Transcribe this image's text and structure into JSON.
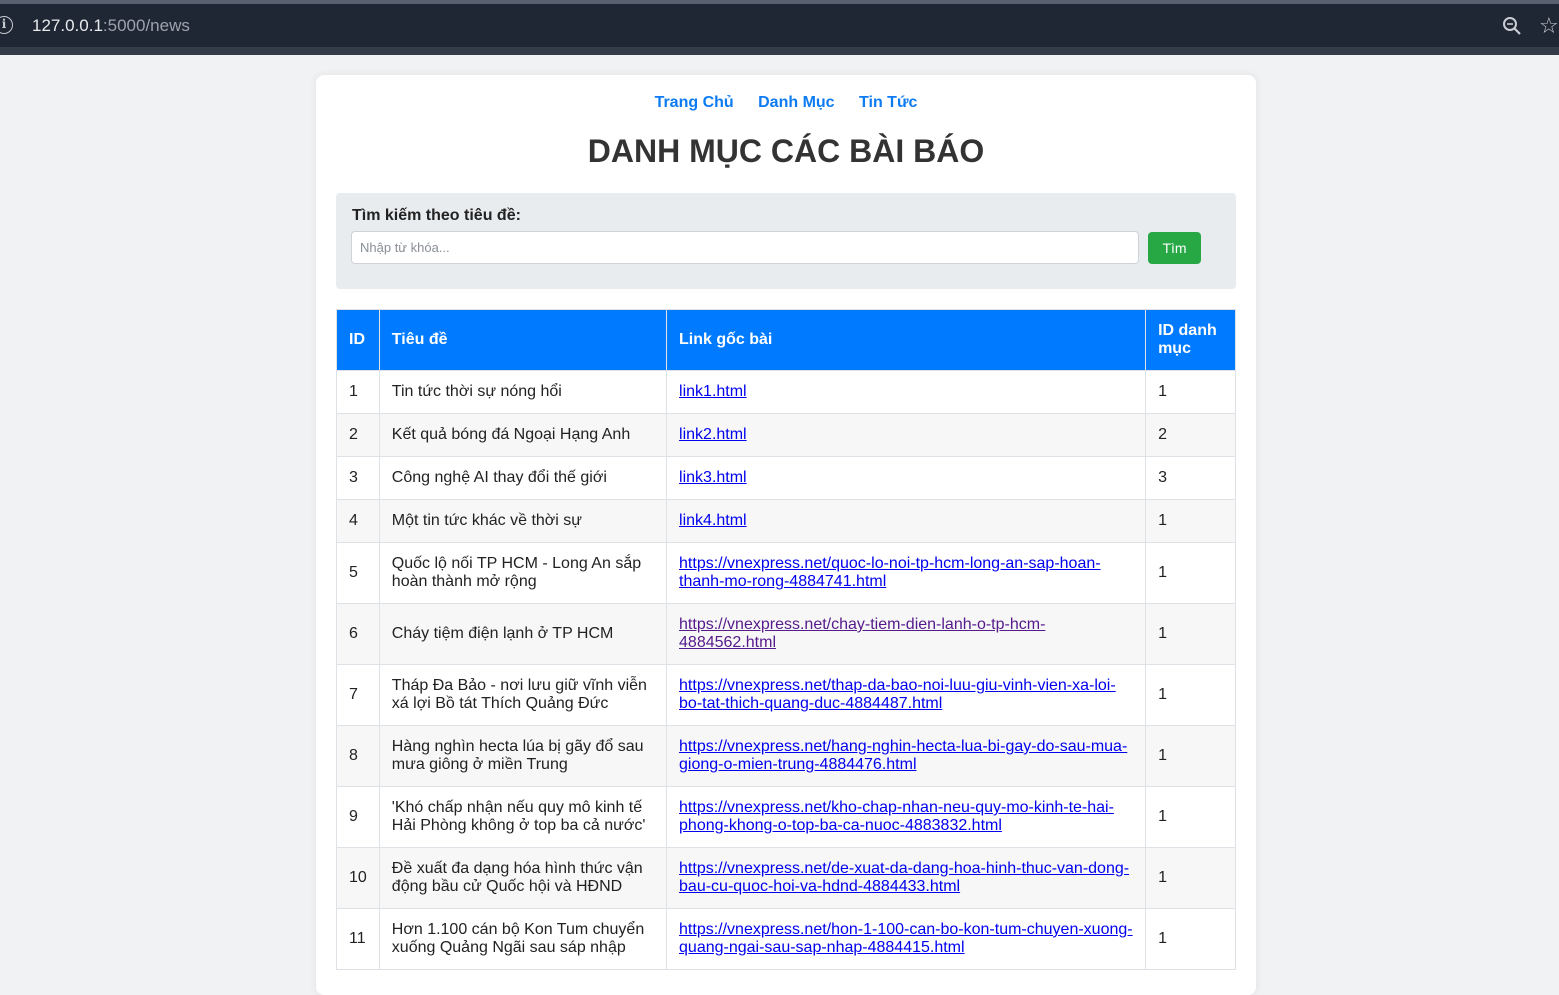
{
  "browser": {
    "url_host": "127.0.0.1",
    "url_rest": ":5000/news"
  },
  "nav": {
    "items": [
      "Trang Chủ",
      "Danh Mục",
      "Tin Tức"
    ]
  },
  "page_title": "DANH MỤC CÁC BÀI BÁO",
  "search": {
    "label": "Tìm kiếm theo tiêu đề:",
    "placeholder": "Nhập từ khóa...",
    "button_label": "Tìm"
  },
  "table": {
    "headers": [
      "ID",
      "Tiêu đề",
      "Link gốc bài",
      "ID danh mục"
    ],
    "rows": [
      {
        "id": "1",
        "title": "Tin tức thời sự nóng hổi",
        "link": "link1.html",
        "cat": "1"
      },
      {
        "id": "2",
        "title": "Kết quả bóng đá Ngoại Hạng Anh",
        "link": "link2.html",
        "cat": "2"
      },
      {
        "id": "3",
        "title": "Công nghệ AI thay đổi thế giới",
        "link": "link3.html",
        "cat": "3"
      },
      {
        "id": "4",
        "title": "Một tin tức khác về thời sự",
        "link": "link4.html",
        "cat": "1"
      },
      {
        "id": "5",
        "title": "Quốc lộ nối TP HCM - Long An sắp hoàn thành mở rộng",
        "link": "https://vnexpress.net/quoc-lo-noi-tp-hcm-long-an-sap-hoan-thanh-mo-rong-4884741.html",
        "cat": "1"
      },
      {
        "id": "6",
        "title": "Cháy tiệm điện lạnh ở TP HCM",
        "link": "https://vnexpress.net/chay-tiem-dien-lanh-o-tp-hcm-4884562.html",
        "cat": "1"
      },
      {
        "id": "7",
        "title": "Tháp Đa Bảo - nơi lưu giữ vĩnh viễn xá lợi Bồ tát Thích Quảng Đức",
        "link": "https://vnexpress.net/thap-da-bao-noi-luu-giu-vinh-vien-xa-loi-bo-tat-thich-quang-duc-4884487.html",
        "cat": "1"
      },
      {
        "id": "8",
        "title": "Hàng nghìn hecta lúa bị gãy đổ sau mưa giông ở miền Trung",
        "link": "https://vnexpress.net/hang-nghin-hecta-lua-bi-gay-do-sau-mua-giong-o-mien-trung-4884476.html",
        "cat": "1"
      },
      {
        "id": "9",
        "title": "'Khó chấp nhận nếu quy mô kinh tế Hải Phòng không ở top ba cả nước'",
        "link": "https://vnexpress.net/kho-chap-nhan-neu-quy-mo-kinh-te-hai-phong-khong-o-top-ba-ca-nuoc-4883832.html",
        "cat": "1"
      },
      {
        "id": "10",
        "title": "Đề xuất đa dạng hóa hình thức vận động bầu cử Quốc hội và HĐND",
        "link": "https://vnexpress.net/de-xuat-da-dang-hoa-hinh-thuc-van-dong-bau-cu-quoc-hoi-va-hdnd-4884433.html",
        "cat": "1"
      },
      {
        "id": "11",
        "title": "Hơn 1.100 cán bộ Kon Tum chuyển xuống Quảng Ngãi sau sáp nhập",
        "link": "https://vnexpress.net/hon-1-100-can-bo-kon-tum-chuyen-xuong-quang-ngai-sau-sap-nhap-4884415.html",
        "cat": "1"
      }
    ]
  }
}
